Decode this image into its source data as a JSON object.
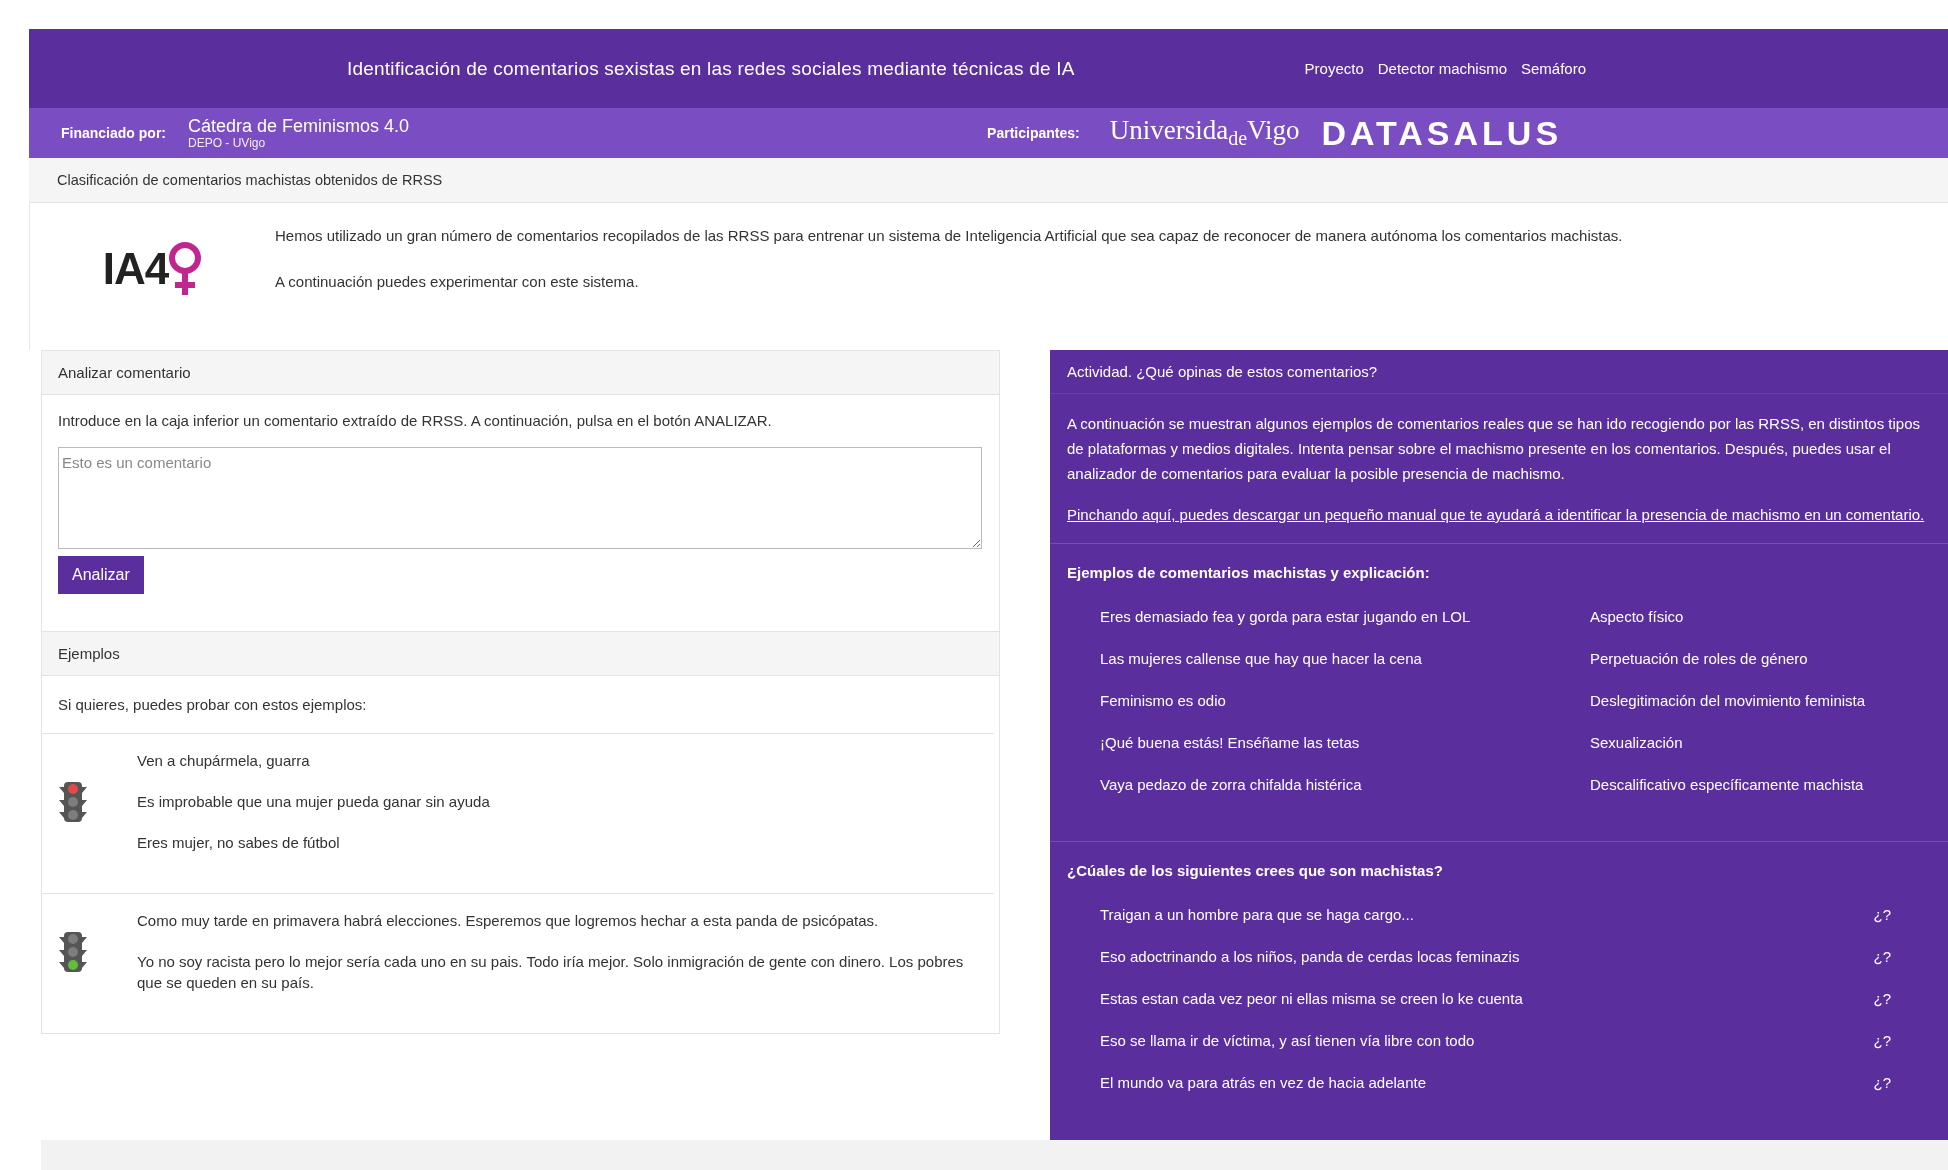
{
  "nav": {
    "title": "Identificación de comentarios sexistas en las redes sociales mediante técnicas de IA",
    "links": [
      {
        "label": "Proyecto"
      },
      {
        "label": "Detector machismo"
      },
      {
        "label": "Semáforo"
      }
    ]
  },
  "funding": {
    "label": "Financiado por:",
    "name": "Cátedra de Feminismos 4.0",
    "subtitle": "DEPO - UVigo",
    "participants_label": "Participantes:",
    "partners": [
      {
        "kind": "serif",
        "text": "Universida$_{de}$Vigo"
      },
      {
        "kind": "wide",
        "text": "DATASALUS"
      }
    ]
  },
  "breadcrumb": "Clasificación de comentarios machistas obtenidos de RRSS",
  "intro": {
    "logo": "IA4",
    "paragraphs": [
      "Hemos utilizado un gran número de comentarios recopilados de las RRSS para entrenar un sistema de Inteligencia Artificial que sea capaz de reconocer de manera autónoma los comentarios machistas.",
      "A continuación puedes experimentar con este sistema."
    ]
  },
  "analyzer": {
    "title": "Analizar comentario",
    "instructions": "Introduce en la caja inferior un comentario extraído de RRSS. A continuación, pulsa en el botón ANALIZAR.",
    "input": {
      "placeholder": "Esto es un comentario"
    },
    "button": "Analizar"
  },
  "examples": {
    "title": "Ejemplos",
    "intro": "Si quieres, puedes probar con estos ejemplos:",
    "groups": [
      {
        "kind": "stop",
        "comments": [
          "Ven a chupármela, guarra",
          "Es improbable que una mujer pueda ganar sin ayuda",
          "Eres mujer, no sabes de fútbol"
        ]
      },
      {
        "kind": "go",
        "comments": [
          "Como muy tarde en primavera habrá elecciones. Esperemos que logremos hechar a esta panda de psicópatas.",
          "Yo no soy racista pero lo mejor sería cada uno en su pais. Todo iría mejor. Solo inmigración de gente con dinero. Los pobres que se queden en su país."
        ]
      }
    ]
  },
  "activity": {
    "title": "Actividad. ¿Qué opinas de estos comentarios?",
    "description": "A continuación se muestran algunos ejemplos de comentarios reales que se han ido recogiendo por las RRSS, en distintos tipos de plataformas y medios digitales. Intenta pensar sobre el machismo presente en los comentarios. Después, puedes usar el analizador de comentarios para evaluar la posible presencia de machismo.",
    "manual_link": "Pinchando aquí, puedes descargar un pequeño manual que te ayudará a identificar la presencia de machismo en un comentario.",
    "explained": {
      "heading": "Ejemplos de comentarios machistas y explicación:",
      "rows": [
        {
          "comment": "Eres demasiado fea y gorda para estar jugando en LOL",
          "explanation": "Aspecto físico"
        },
        {
          "comment": "Las mujeres callense que hay que hacer la cena",
          "explanation": "Perpetuación de roles de género"
        },
        {
          "comment": "Feminismo es odio",
          "explanation": "Deslegitimación del movimiento feminista"
        },
        {
          "comment": "¡Qué buena estás! Enséñame las tetas",
          "explanation": "Sexualización"
        },
        {
          "comment": "Vaya pedazo de zorra chifalda histérica",
          "explanation": "Descalificativo específicamente machista"
        }
      ]
    },
    "quiz": {
      "heading": "¿Cúales de los siguientes crees que son machistas?",
      "rows": [
        {
          "comment": "Traigan a un hombre para que se haga cargo...",
          "marker": "¿?"
        },
        {
          "comment": "Eso adoctrinando a los niños, panda de cerdas locas feminazis",
          "marker": "¿?"
        },
        {
          "comment": "Estas estan cada vez peor ni ellas misma se creen lo ke cuenta",
          "marker": "¿?"
        },
        {
          "comment": "Eso se llama ir de víctima, y así tienen vía libre con todo",
          "marker": "¿?"
        },
        {
          "comment": "El mundo va para atrás en vez de hacia adelante",
          "marker": "¿?"
        }
      ]
    }
  }
}
